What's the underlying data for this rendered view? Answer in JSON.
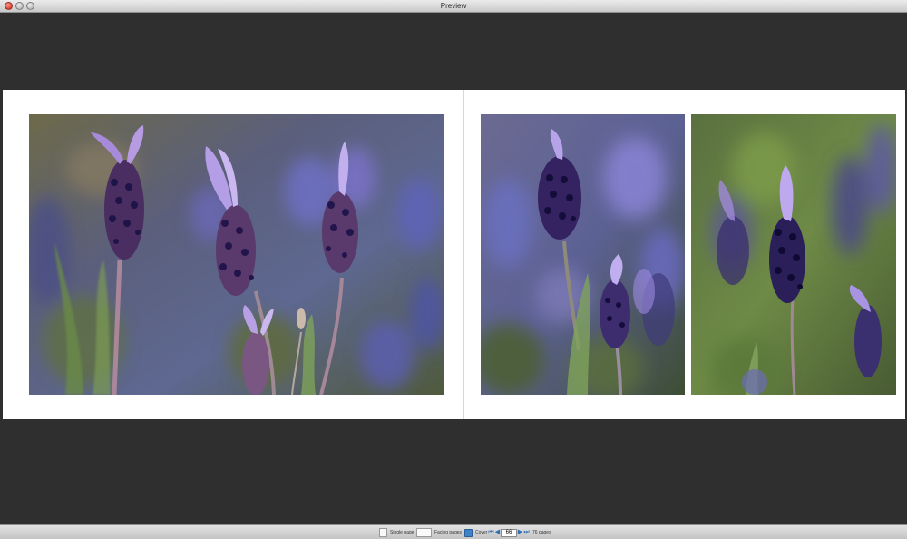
{
  "window": {
    "title": "Preview"
  },
  "toolbar": {
    "single_label": "Single page",
    "facing_label": "Facing pages",
    "cover_label": "Cover",
    "page_value": "66",
    "total_label": "76 pages"
  },
  "icons": {
    "first": "first-page-icon",
    "prev": "previous-page-icon",
    "next": "next-page-icon",
    "last": "last-page-icon"
  },
  "colors": {
    "accent": "#3f82c7",
    "canvas": "#2f2f2f"
  }
}
